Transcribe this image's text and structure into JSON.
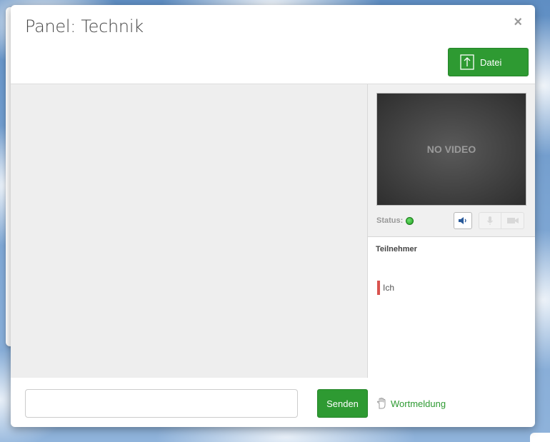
{
  "modal": {
    "title": "Panel: Technik",
    "close_label": "×",
    "file_button_label": "Datei"
  },
  "video": {
    "placeholder": "NO VIDEO",
    "status_label": "Status:",
    "status_color": "#2aa52a",
    "controls": [
      {
        "icon": "speaker-icon",
        "active": true
      },
      {
        "icon": "microphone-icon",
        "active": false
      },
      {
        "icon": "camera-icon",
        "active": false
      }
    ]
  },
  "participants": {
    "title": "Teilnehmer",
    "items": [
      {
        "name": "Ich",
        "color": "#d9534f"
      }
    ]
  },
  "footer": {
    "input_value": "",
    "input_placeholder": "",
    "send_label": "Senden",
    "raise_hand_label": "Wortmeldung"
  },
  "colors": {
    "accent": "#2e9a32"
  }
}
